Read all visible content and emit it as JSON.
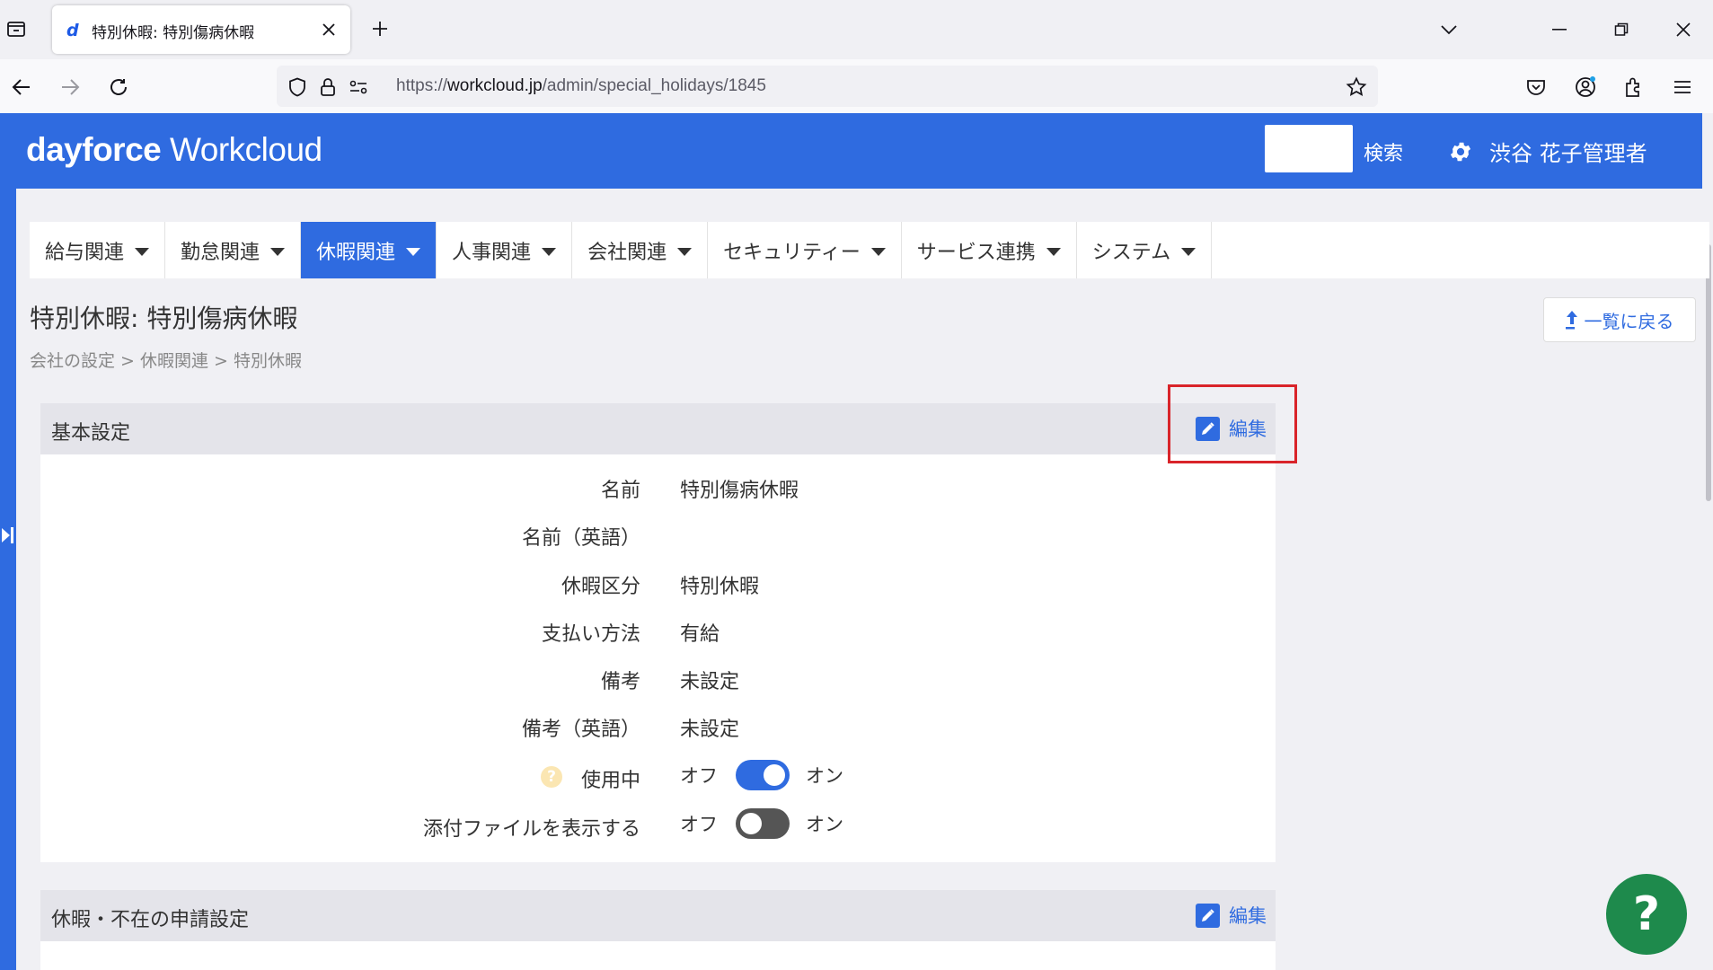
{
  "browser": {
    "tab_title": "特別休暇: 特別傷病休暇",
    "tab_favicon": "d",
    "url_prefix": "https://",
    "url_host": "workcloud.jp",
    "url_path": "/admin/special_holidays/1845"
  },
  "header": {
    "logo_bold": "dayforce",
    "logo_light": " Workcloud",
    "search_label": "検索",
    "search_value": "",
    "user_name": "渋谷 花子管理者"
  },
  "menu": {
    "items": [
      {
        "label": "給与関連"
      },
      {
        "label": "勤怠関連"
      },
      {
        "label": "休暇関連"
      },
      {
        "label": "人事関連"
      },
      {
        "label": "会社関連"
      },
      {
        "label": "セキュリティー"
      },
      {
        "label": "サービス連携"
      },
      {
        "label": "システム"
      }
    ],
    "active_index": 2
  },
  "page": {
    "title": "特別休暇: 特別傷病休暇",
    "breadcrumb": "会社の設定 > 休暇関連 > 特別休暇",
    "back_label": "一覧に戻る"
  },
  "basic": {
    "title": "基本設定",
    "edit_label": "編集",
    "fields": [
      {
        "label": "名前",
        "value": "特別傷病休暇"
      },
      {
        "label": "名前（英語）",
        "value": ""
      },
      {
        "label": "休暇区分",
        "value": "特別休暇"
      },
      {
        "label": "支払い方法",
        "value": "有給"
      },
      {
        "label": "備考",
        "value": "未設定"
      },
      {
        "label": "備考（英語）",
        "value": "未設定"
      }
    ],
    "in_use": {
      "label": "使用中",
      "off": "オフ",
      "on": "オン",
      "state": "on"
    },
    "show_attachments": {
      "label": "添付ファイルを表示する",
      "off": "オフ",
      "on": "オン",
      "state": "off"
    }
  },
  "request_settings": {
    "title": "休暇・不在の申請設定",
    "edit_label": "編集"
  },
  "help_fab": "?"
}
